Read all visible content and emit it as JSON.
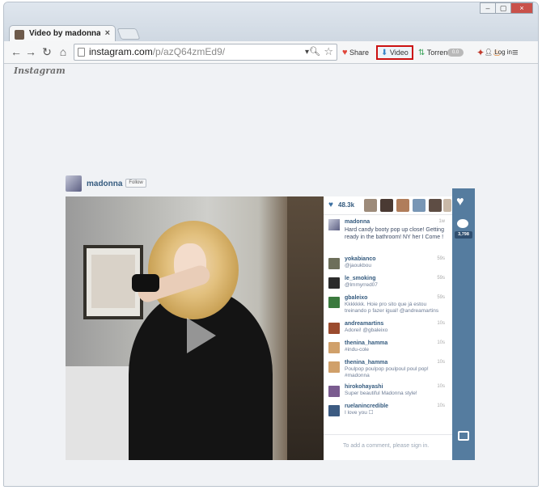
{
  "browser": {
    "tab_title": "Video by madonna • Insta",
    "tab_close": "×",
    "url_host": "instagram.com",
    "url_path": "/p/azQ64zmEd9/",
    "zoom_glyph": "▾",
    "extensions": {
      "share_label": "Share",
      "video_label": "Video",
      "torrent_label": "Torrent",
      "torrent_badge": "0.0"
    },
    "window_controls": [
      "–",
      "▢",
      "×"
    ],
    "accent": "#cc1111"
  },
  "header": {
    "logo": "Instagram",
    "login_label": "Log in"
  },
  "post": {
    "username": "madonna",
    "follow_label": "Follow",
    "likes": "48.3k",
    "comments_count": "3,798",
    "caption": {
      "user": "madonna",
      "time": "1w",
      "text": "Hard candy booty pop up close! Getting ready in the bathroom! NY her I Come !"
    },
    "comments": [
      {
        "user": "yokabianco",
        "text": "@jaoukbou",
        "time": "59s",
        "color": "#6d6f5a"
      },
      {
        "user": "le_smoking",
        "text": "@lmmyrred07",
        "time": "59s",
        "color": "#2b2b2b"
      },
      {
        "user": "gbaleixo",
        "text": "Kkkkkkk. Hoie pro sito que já estou treinando p fazer igual! @andreamartins",
        "time": "59s",
        "color": "#3b7a3e"
      },
      {
        "user": "andreamartins",
        "text": "Adorei! @gbaleixo",
        "time": "10s",
        "color": "#9b4b2e"
      },
      {
        "user": "thenina_hamma",
        "text": "#indu-cole",
        "time": "10s",
        "color": "#d0a06a"
      },
      {
        "user": "thenina_hamma",
        "text": "Poulpop poulpop poulpoul poul pop! #madonna",
        "time": "10s",
        "color": "#d0a06a"
      },
      {
        "user": "hirokohayashi",
        "text": "Super beautiful Madonna style!",
        "time": "10s",
        "color": "#7a5b8f"
      },
      {
        "user": "ruelanincredible",
        "text": "I love you ☐",
        "time": "10s",
        "color": "#3c5b82"
      }
    ],
    "add_comment_placeholder": "To add a comment, please sign in."
  }
}
